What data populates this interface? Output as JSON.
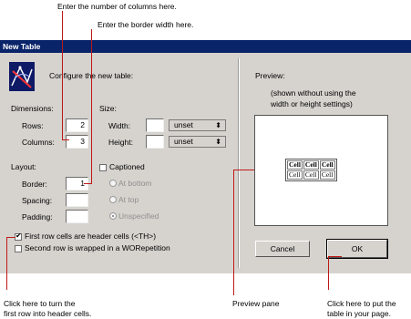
{
  "annotations": {
    "columns": "Enter the number of columns here.",
    "border": "Enter the border width here.",
    "header_line1": "Click here to turn the",
    "header_line2": "first row into header cells.",
    "preview": "Preview pane",
    "ok_line1": "Click here to put the",
    "ok_line2": "table in your page."
  },
  "window": {
    "title": "New Table",
    "configure_label": "Configure the new table:"
  },
  "dimensions": {
    "heading": "Dimensions:",
    "rows_label": "Rows:",
    "rows_value": "2",
    "columns_label": "Columns:",
    "columns_value": "3"
  },
  "size": {
    "heading": "Size:",
    "width_label": "Width:",
    "width_value": "",
    "width_unit": "unset",
    "height_label": "Height:",
    "height_value": "",
    "height_unit": "unset"
  },
  "layout": {
    "heading": "Layout:",
    "border_label": "Border:",
    "border_value": "1",
    "spacing_label": "Spacing:",
    "spacing_value": "",
    "padding_label": "Padding:",
    "padding_value": ""
  },
  "caption": {
    "label": "Captioned",
    "checked": false,
    "options": [
      "At bottom",
      "At top",
      "Unspecified"
    ],
    "selected": "Unspecified"
  },
  "options": {
    "header_cells_label": "First row cells are header cells (<TH>)",
    "header_cells_checked": true,
    "worepetition_label": "Second row is wrapped in a WORepetition",
    "worepetition_checked": false
  },
  "preview": {
    "heading": "Preview:",
    "note_line1": "(shown without using the",
    "note_line2": "width or height settings)",
    "table_rows": [
      [
        "Cell",
        "Cell",
        "Cell"
      ],
      [
        "Cell",
        "Cell",
        "Cell"
      ]
    ]
  },
  "buttons": {
    "cancel": "Cancel",
    "ok": "OK"
  },
  "colors": {
    "dialog_bg": "#d6d3ce",
    "titlebar": "#0a246a",
    "callout_line": "#c01818"
  },
  "icons": {
    "app": "table-wizard-icon",
    "select_arrow": "up-down-arrows-icon",
    "check": "checkmark-icon"
  }
}
